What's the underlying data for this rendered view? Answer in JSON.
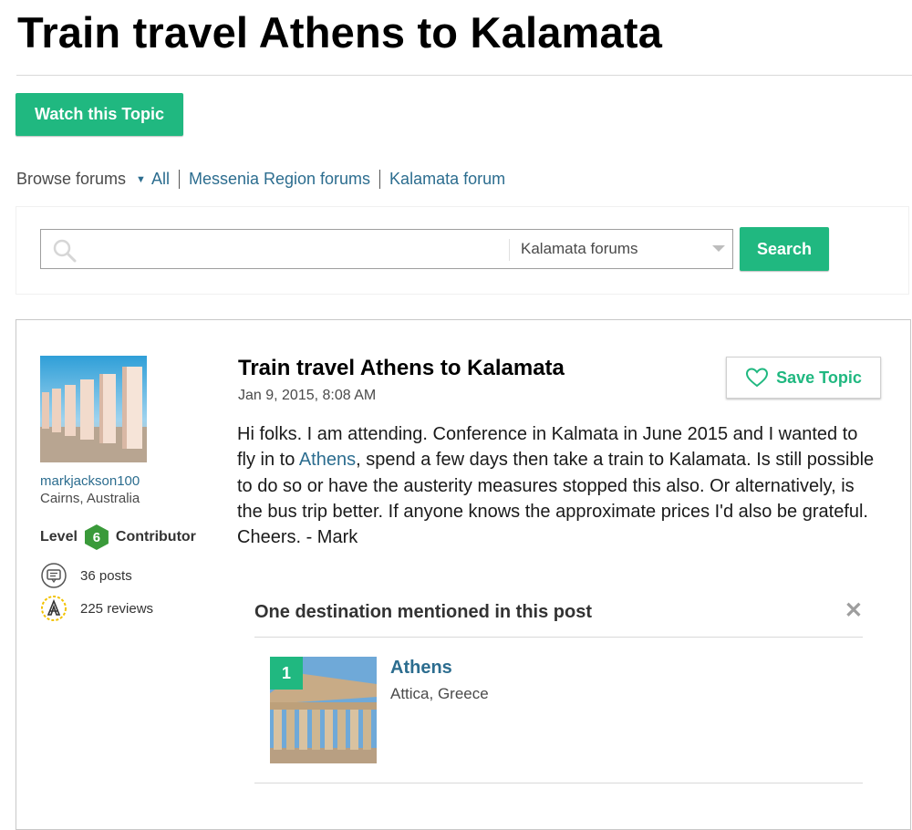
{
  "page": {
    "title": "Train travel Athens to Kalamata"
  },
  "actions": {
    "watch_label": "Watch this Topic"
  },
  "breadcrumb": {
    "browse_label": "Browse forums",
    "all_label": "All",
    "links": [
      "Messenia Region forums",
      "Kalamata forum"
    ]
  },
  "search": {
    "value": "",
    "placeholder": "",
    "scope": "Kalamata forums",
    "button_label": "Search"
  },
  "post": {
    "author": {
      "username": "markjackson100",
      "location": "Cairns, Australia",
      "level_label": "Level",
      "level": "6",
      "level_title": "Contributor",
      "posts": "36 posts",
      "reviews": "225 reviews"
    },
    "title": "Train travel Athens to Kalamata",
    "date": "Jan 9, 2015, 8:08 AM",
    "save_label": "Save Topic",
    "body_before": "Hi folks. I am attending. Conference in Kalmata in June 2015 and I wanted to fly in to ",
    "body_link": "Athens",
    "body_after": ", spend a few days then take a train to Kalamata. Is still possible to do so or have the austerity measures stopped this also. Or alternatively, is the bus trip better. If anyone knows the approximate prices I'd also be grateful. Cheers. - Mark"
  },
  "destinations": {
    "heading": "One destination mentioned in this post",
    "items": [
      {
        "rank": "1",
        "name": "Athens",
        "region": "Attica, Greece"
      }
    ]
  },
  "colors": {
    "accent": "#20b880",
    "link": "#2c6d8f",
    "level_badge": "#3a9a3a"
  },
  "icons": [
    "search-icon",
    "chevron-down-icon",
    "heart-icon",
    "close-icon",
    "speech-bubble-icon",
    "reviewer-badge-icon"
  ]
}
